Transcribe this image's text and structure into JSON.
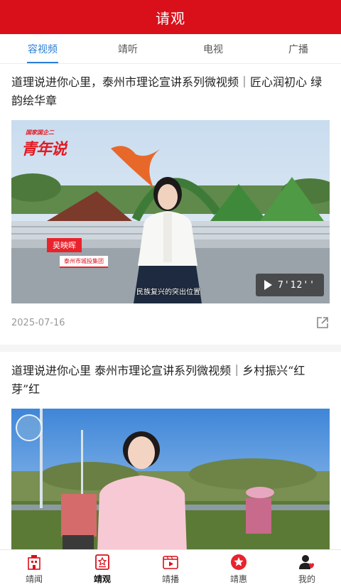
{
  "header": {
    "title": "请观"
  },
  "tabs": [
    {
      "label": "容视频",
      "active": true
    },
    {
      "label": "靖听",
      "active": false
    },
    {
      "label": "电视",
      "active": false
    },
    {
      "label": "广播",
      "active": false
    }
  ],
  "articles": [
    {
      "title": "道理说进你心里，泰州市理论宣讲系列微视频｜匠心润初心 绿韵绘华章",
      "date": "2025-07-16",
      "duration": "7'12''",
      "show_logo_small": "国家国企二",
      "show_logo_big": "青年说",
      "presenter_name": "吴映晖",
      "presenter_org": "泰州市城投集团",
      "subtitle": "民族复兴的突出位置"
    },
    {
      "title": "道理说进你心里 泰州市理论宣讲系列微视频｜乡村振兴“红芽”红"
    }
  ],
  "bottom_nav": [
    {
      "label": "靖闻",
      "icon": "news-building-icon",
      "active": false
    },
    {
      "label": "靖观",
      "icon": "watch-badge-icon",
      "active": true
    },
    {
      "label": "靖播",
      "icon": "video-play-icon",
      "active": false
    },
    {
      "label": "靖惠",
      "icon": "star-circle-icon",
      "active": false
    },
    {
      "label": "我的",
      "icon": "user-heart-icon",
      "active": false
    }
  ],
  "colors": {
    "brand_red": "#d9101a",
    "tab_active_blue": "#2a7fd6"
  }
}
